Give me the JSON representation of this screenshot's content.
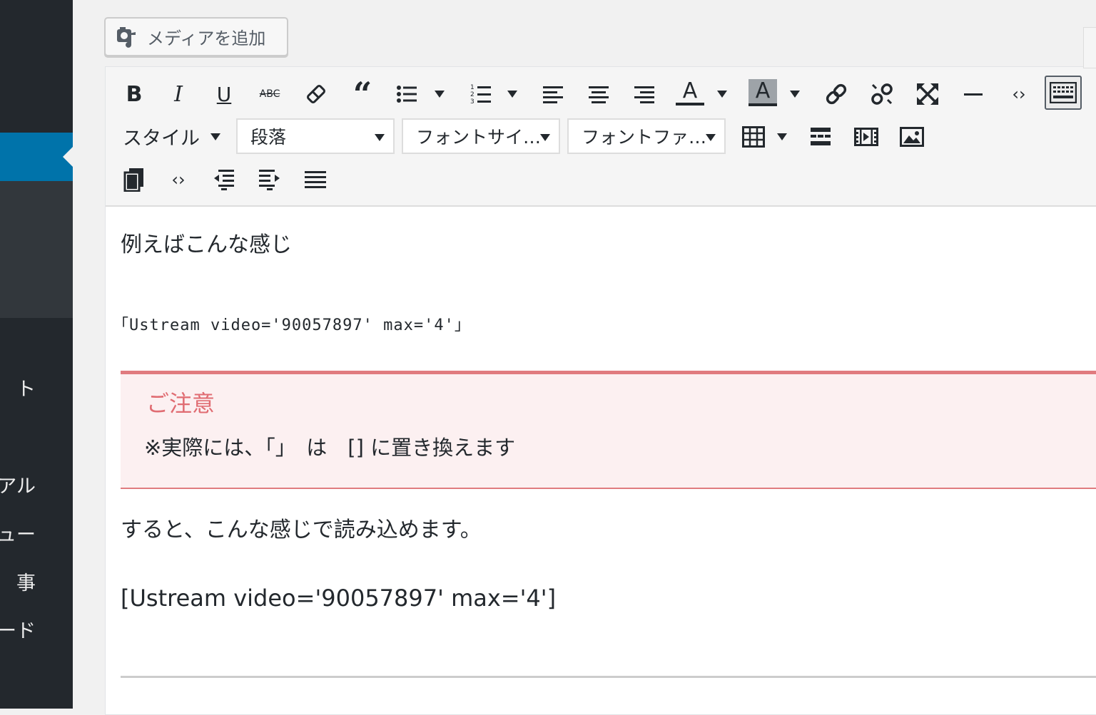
{
  "sidebar": {
    "items": [
      {
        "label": "ト"
      },
      {
        "label": "アル"
      },
      {
        "label": "ュー"
      },
      {
        "label": "事"
      },
      {
        "label": "ード"
      }
    ]
  },
  "media_button": {
    "label": "メディアを追加",
    "icon": "media-icon"
  },
  "toolbar": {
    "row1": [
      "bold",
      "italic",
      "underline",
      "strikethrough",
      "eraser",
      "blockquote",
      "bullet-list",
      "numbered-list",
      "align-left",
      "align-center",
      "align-right",
      "text-color",
      "background-color",
      "link",
      "unlink",
      "fullscreen",
      "horizontal-rule",
      "code",
      "toolbar-toggle"
    ],
    "style_label": "スタイル",
    "format_select": "段落",
    "font_size_select": "フォントサイ…",
    "font_family_select": "フォントファ…",
    "text_bold": "B",
    "text_italic": "I",
    "text_underline": "U",
    "text_strike": "ABC",
    "text_color_letter": "A",
    "bg_color_letter": "A"
  },
  "content": {
    "line1": "例えばこんな感じ",
    "shortcode_example": "「Ustream video='90057897' max='4'」",
    "notice_title": "ご注意",
    "notice_body": "※実際には、「」　は　[] に置き換えます",
    "line2": "すると、こんな感じで読み込めます。",
    "shortcode": "[Ustream video='90057897' max='4']"
  },
  "colors": {
    "sidebar_bg": "#23282d",
    "sidebar_active": "#0073aa",
    "notice_border": "#e07b7f",
    "notice_bg": "#fcf0f1",
    "notice_title": "#e06c72"
  }
}
